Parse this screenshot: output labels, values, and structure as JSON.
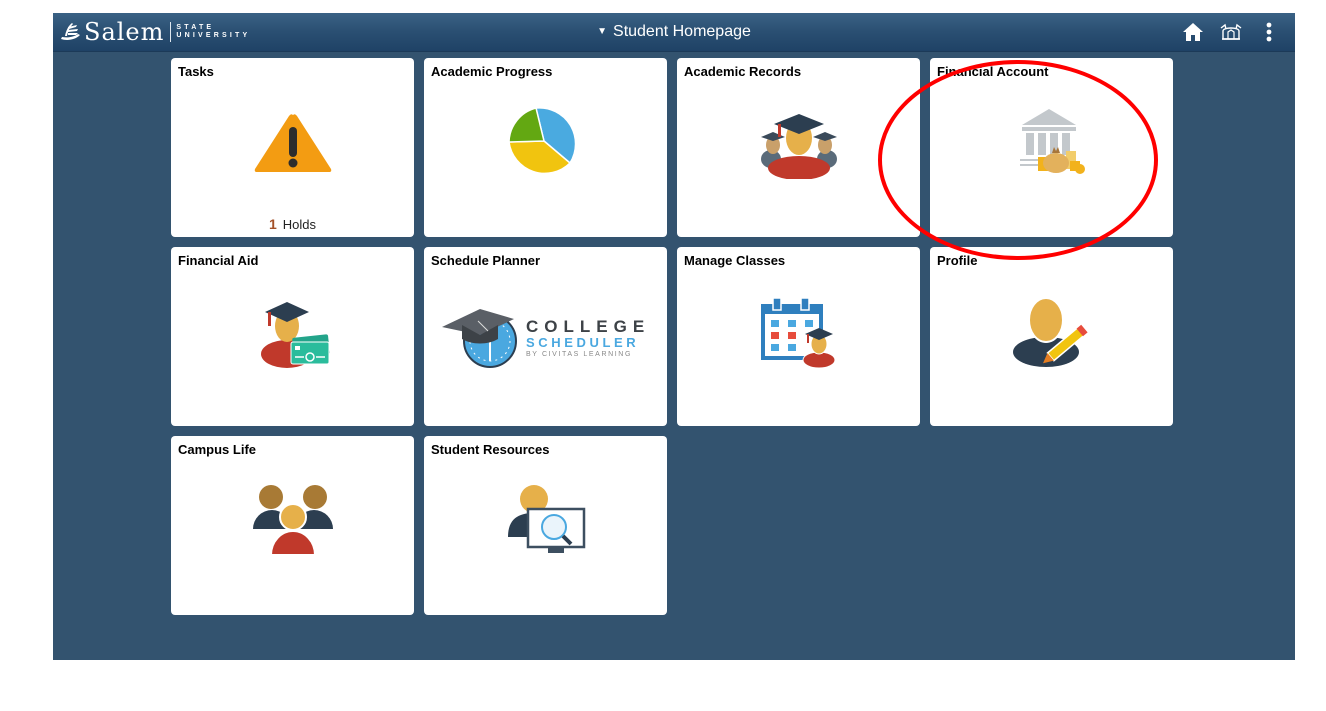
{
  "header": {
    "logo": {
      "name": "Salem",
      "sub_line1": "STATE",
      "sub_line2": "UNIVERSITY"
    },
    "title": "Student Homepage",
    "title_dropdown_icon": "caret-down-icon",
    "icons": [
      "home-icon",
      "navbar-icon",
      "actions-menu-icon"
    ]
  },
  "tiles": [
    {
      "label": "Tasks",
      "icon": "warning-icon",
      "footer_count": "1",
      "footer_text": "Holds"
    },
    {
      "label": "Academic Progress",
      "icon": "pie-chart-icon"
    },
    {
      "label": "Academic Records",
      "icon": "graduates-icon"
    },
    {
      "label": "Financial Account",
      "icon": "bank-icon",
      "highlighted": true
    },
    {
      "label": "Financial Aid",
      "icon": "graduate-money-icon"
    },
    {
      "label": "Schedule Planner",
      "icon": "college-scheduler-logo",
      "logo_text": {
        "line1": "COLLEGE",
        "line2": "SCHEDULER",
        "line3": "BY CIVITAS LEARNING"
      }
    },
    {
      "label": "Manage Classes",
      "icon": "calendar-graduate-icon"
    },
    {
      "label": "Profile",
      "icon": "profile-edit-icon"
    },
    {
      "label": "Campus Life",
      "icon": "group-icon"
    },
    {
      "label": "Student Resources",
      "icon": "person-monitor-search-icon"
    }
  ],
  "colors": {
    "background": "#33536f",
    "header": "#2a4f72",
    "annotation": "#ff0000",
    "hold_count": "#a45128"
  }
}
